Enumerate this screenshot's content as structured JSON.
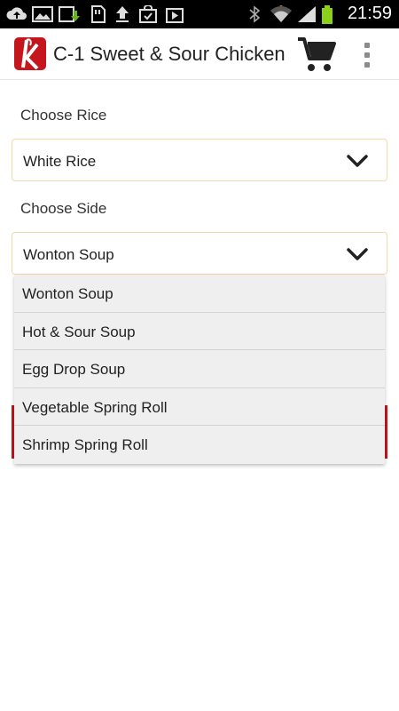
{
  "status_bar": {
    "time": "21:59",
    "icons": [
      "upload-icon",
      "image-icon",
      "download-icon",
      "sd-card-icon",
      "upload-arrow-icon",
      "shopping-bag-icon",
      "play-store-icon",
      "bluetooth-icon",
      "wifi-icon",
      "signal-icon",
      "battery-icon"
    ]
  },
  "action_bar": {
    "title": "C-1 Sweet & Sour Chicken",
    "logo_icon": "brand-logo-icon",
    "cart_icon": "shopping-cart-icon",
    "overflow_icon": "overflow-menu-icon"
  },
  "form": {
    "rice": {
      "label": "Choose Rice",
      "selected": "White Rice"
    },
    "side": {
      "label": "Choose Side",
      "selected": "Wonton Soup",
      "options": [
        "Wonton Soup",
        "Hot & Sour Soup",
        "Egg Drop Soup",
        "Vegetable Spring Roll",
        "Shrimp Spring Roll"
      ]
    }
  },
  "colors": {
    "brand_red": "#c4161c",
    "select_border": "#f5d9a8",
    "dropdown_bg": "#efefef"
  }
}
